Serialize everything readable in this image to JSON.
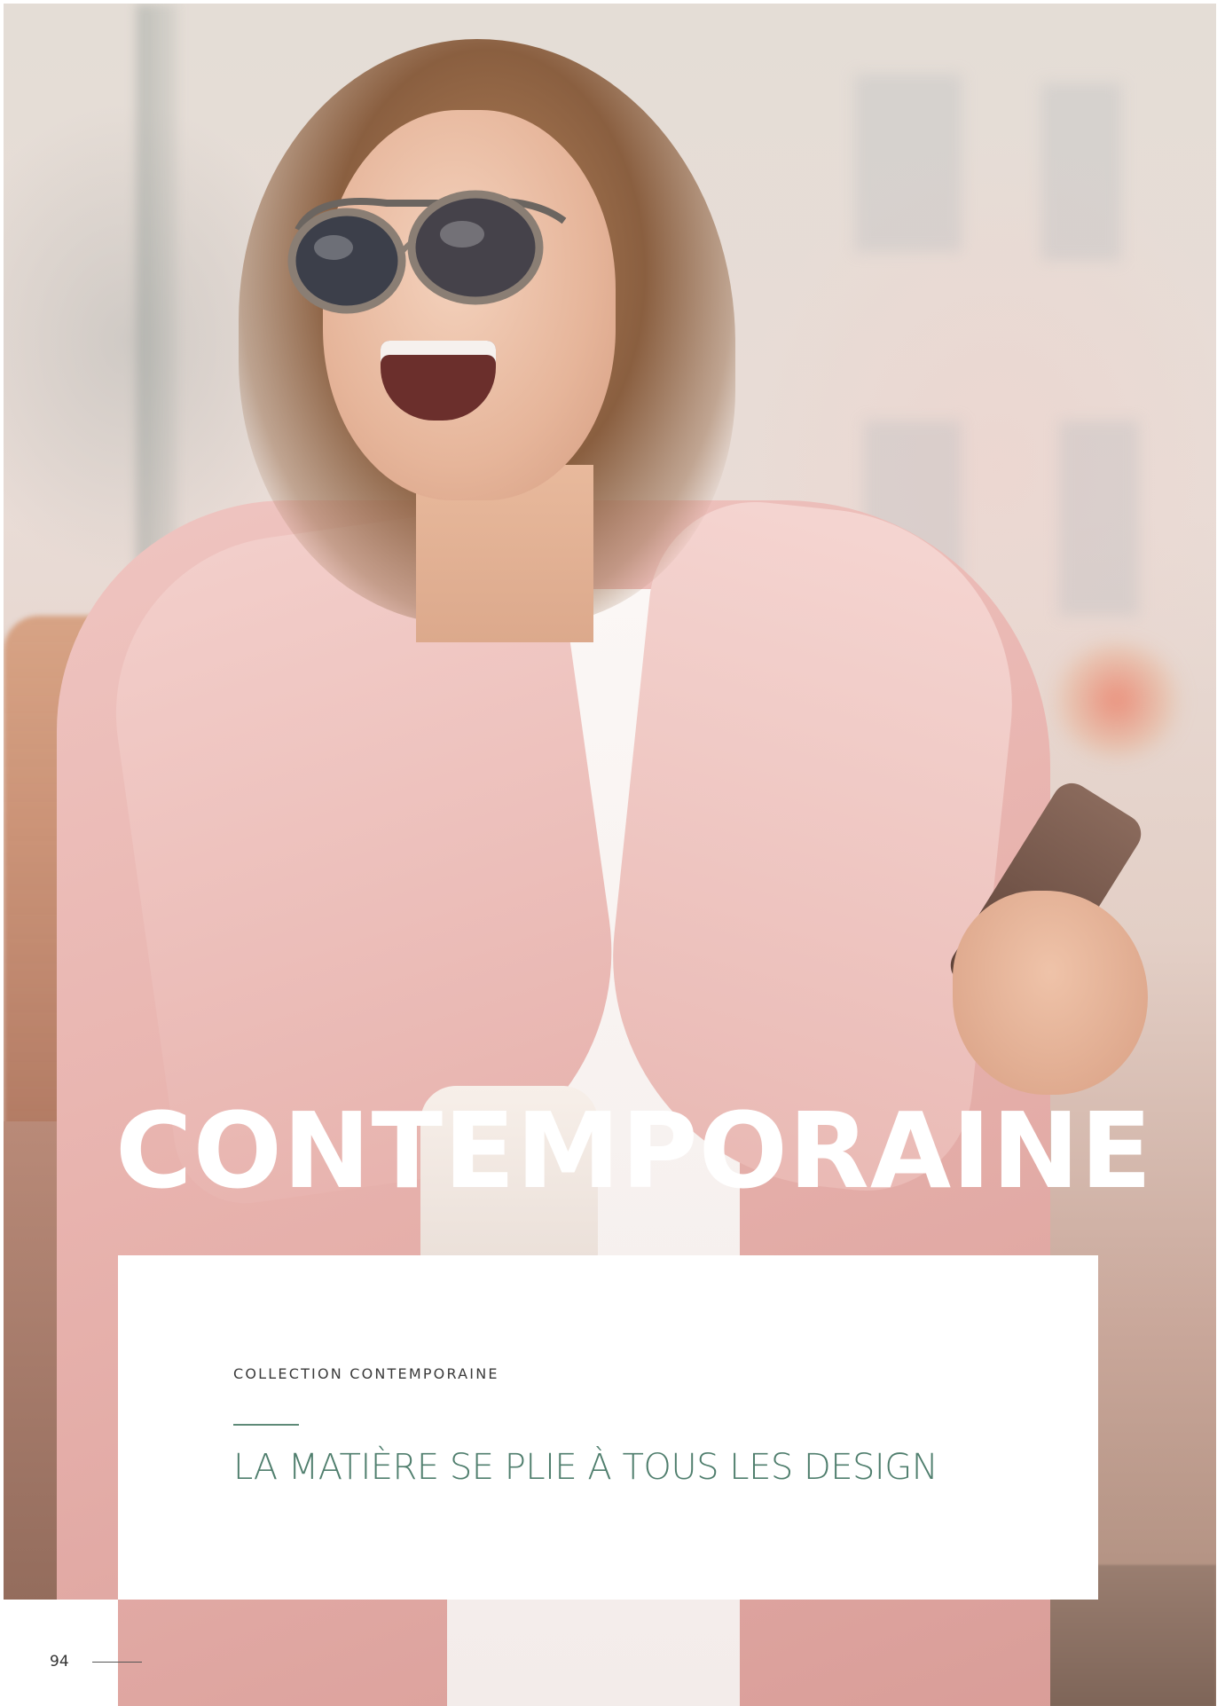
{
  "hero": {
    "title": "CONTEMPORAINE",
    "photo_description_icon": "hero-photo"
  },
  "card": {
    "eyebrow": "COLLECTION CONTEMPORAINE",
    "headline": "LA MATIÈRE SE PLIE À TOUS LES DESIGN"
  },
  "folio": {
    "page_number": "94"
  },
  "colors": {
    "headline_green": "#4f7e6d",
    "rule_green": "#5e8a78",
    "coat_pink": "#e8b3ae",
    "title_white": "#ffffff"
  }
}
